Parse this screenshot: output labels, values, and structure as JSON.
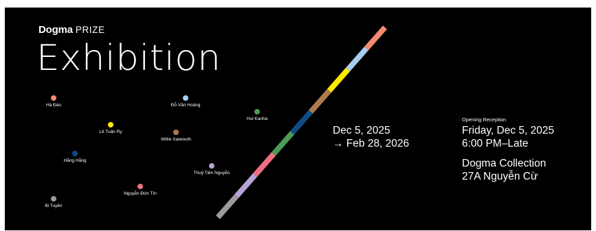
{
  "brand": {
    "name": "Dogma",
    "suffix": "PRIZE"
  },
  "title": "Exhibition",
  "dates": {
    "start": "Dec 5, 2025",
    "end": "→ Feb 28, 2026"
  },
  "reception": {
    "label": "Opening Reception",
    "date": "Friday, Dec 5, 2025",
    "time": "6:00 PM–Late",
    "venue": "Dogma Collection",
    "address": "27A Nguyễn Cừ"
  },
  "artists": [
    {
      "name": "Hà Đào",
      "color": "#f28b70"
    },
    {
      "name": "Đỗ Văn Hoàng",
      "color": "#a9cdee"
    },
    {
      "name": "Hul Kanha",
      "color": "#4d9a54"
    },
    {
      "name": "Lê Tuấn Ry",
      "color": "#ffeb00"
    },
    {
      "name": "Willie Xaiwouth",
      "color": "#b07a4b"
    },
    {
      "name": "Hằng Hằng",
      "color": "#0e4c86"
    },
    {
      "name": "Thuỷ Tiên Nguyễn",
      "color": "#b9a2d6"
    },
    {
      "name": "Nguyễn Đức Tín",
      "color": "#ee6f84"
    },
    {
      "name": "Bi Tuyền",
      "color": "#9b9b9b"
    }
  ],
  "colors": {
    "background": "#000000",
    "text": "#ffffff"
  }
}
